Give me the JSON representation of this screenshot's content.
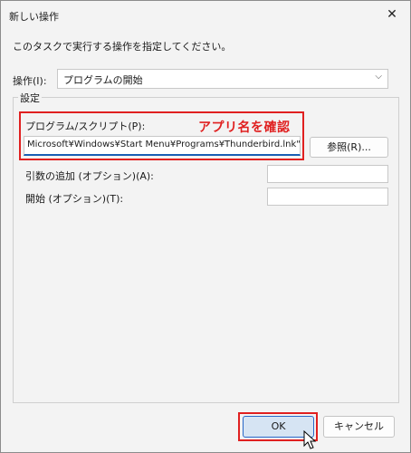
{
  "window": {
    "title": "新しい操作",
    "close_glyph": "✕"
  },
  "instruction": "このタスクで実行する操作を指定してください。",
  "action": {
    "label": "操作(I):",
    "selected": "プログラムの開始"
  },
  "settings": {
    "legend": "設定",
    "program_label": "プログラム/スクリプト(P):",
    "program_value": "Microsoft¥Windows¥Start Menu¥Programs¥Thunderbird.lnk\"|",
    "browse_label": "参照(R)...",
    "args_label": "引数の追加 (オプション)(A):",
    "args_value": "",
    "start_label": "開始 (オプション)(T):",
    "start_value": ""
  },
  "annotation": "アプリ名を確認",
  "buttons": {
    "ok": "OK",
    "cancel": "キャンセル"
  },
  "colors": {
    "highlight": "#e02020",
    "accent": "#1a5fb4"
  }
}
